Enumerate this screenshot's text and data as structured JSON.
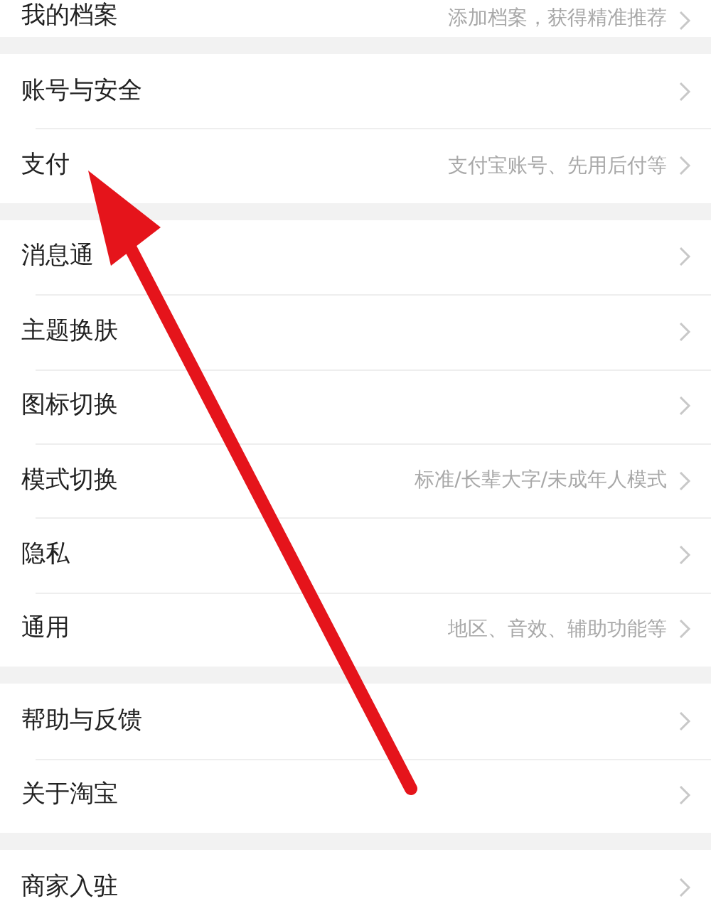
{
  "groups": [
    {
      "items": [
        {
          "label": "我的档案",
          "value": "添加档案，获得精准推荐"
        }
      ]
    },
    {
      "items": [
        {
          "label": "账号与安全"
        },
        {
          "label": "支付",
          "value": "支付宝账号、先用后付等"
        }
      ]
    },
    {
      "items": [
        {
          "label": "消息通"
        },
        {
          "label": "主题换肤"
        },
        {
          "label": "图标切换"
        },
        {
          "label": "模式切换",
          "value": "标准/长辈大字/未成年人模式"
        },
        {
          "label": "隐私"
        },
        {
          "label": "通用",
          "value": "地区、音效、辅助功能等"
        }
      ]
    },
    {
      "items": [
        {
          "label": "帮助与反馈"
        },
        {
          "label": "关于淘宝"
        }
      ]
    },
    {
      "items": [
        {
          "label": "商家入驻"
        }
      ]
    }
  ]
}
